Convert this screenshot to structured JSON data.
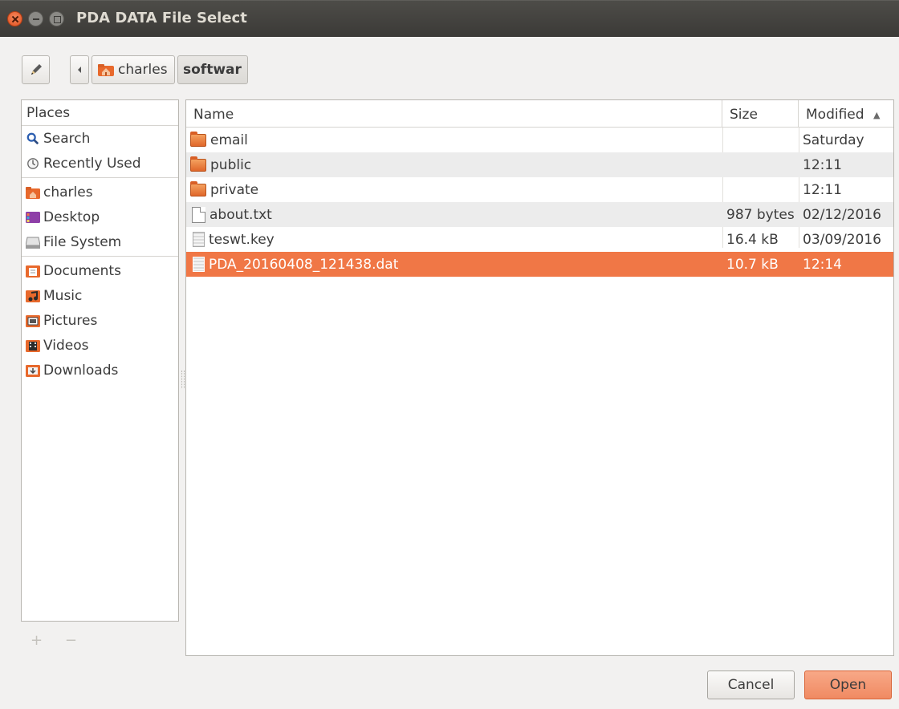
{
  "window": {
    "title": "PDA DATA File Select"
  },
  "toolbar": {
    "edit_icon": "pencil-icon",
    "back_icon": "chevron-left-icon",
    "breadcrumbs": [
      {
        "label": "charles",
        "icon": "home-folder-icon"
      },
      {
        "label": "softwar"
      }
    ]
  },
  "places": {
    "header": "Places",
    "items": [
      {
        "label": "Search",
        "icon": "search-icon"
      },
      {
        "label": "Recently Used",
        "icon": "clock-icon"
      },
      {
        "label": "charles",
        "icon": "home-folder-icon"
      },
      {
        "label": "Desktop",
        "icon": "desktop-icon"
      },
      {
        "label": "File System",
        "icon": "drive-icon"
      },
      {
        "label": "Documents",
        "icon": "documents-folder-icon"
      },
      {
        "label": "Music",
        "icon": "music-folder-icon"
      },
      {
        "label": "Pictures",
        "icon": "pictures-folder-icon"
      },
      {
        "label": "Videos",
        "icon": "videos-folder-icon"
      },
      {
        "label": "Downloads",
        "icon": "downloads-folder-icon"
      }
    ],
    "add_label": "+",
    "remove_label": "−"
  },
  "files": {
    "columns": {
      "name": "Name",
      "size": "Size",
      "modified": "Modified"
    },
    "sort_indicator": "▲",
    "rows": [
      {
        "name": "email",
        "size": "",
        "modified": "Saturday",
        "type": "folder"
      },
      {
        "name": "public",
        "size": "",
        "modified": "12:11",
        "type": "folder"
      },
      {
        "name": "private",
        "size": "",
        "modified": "12:11",
        "type": "folder"
      },
      {
        "name": "about.txt",
        "size": "987 bytes",
        "modified": "02/12/2016",
        "type": "text"
      },
      {
        "name": "teswt.key",
        "size": "16.4 kB",
        "modified": "03/09/2016",
        "type": "binary"
      },
      {
        "name": "PDA_20160408_121438.dat",
        "size": "10.7 kB",
        "modified": "12:14",
        "type": "binary",
        "selected": true
      }
    ]
  },
  "buttons": {
    "cancel": "Cancel",
    "open": "Open"
  },
  "colors": {
    "accent": "#f07746",
    "titlebar": "#3b3a37",
    "window_bg": "#f2f1f0"
  }
}
